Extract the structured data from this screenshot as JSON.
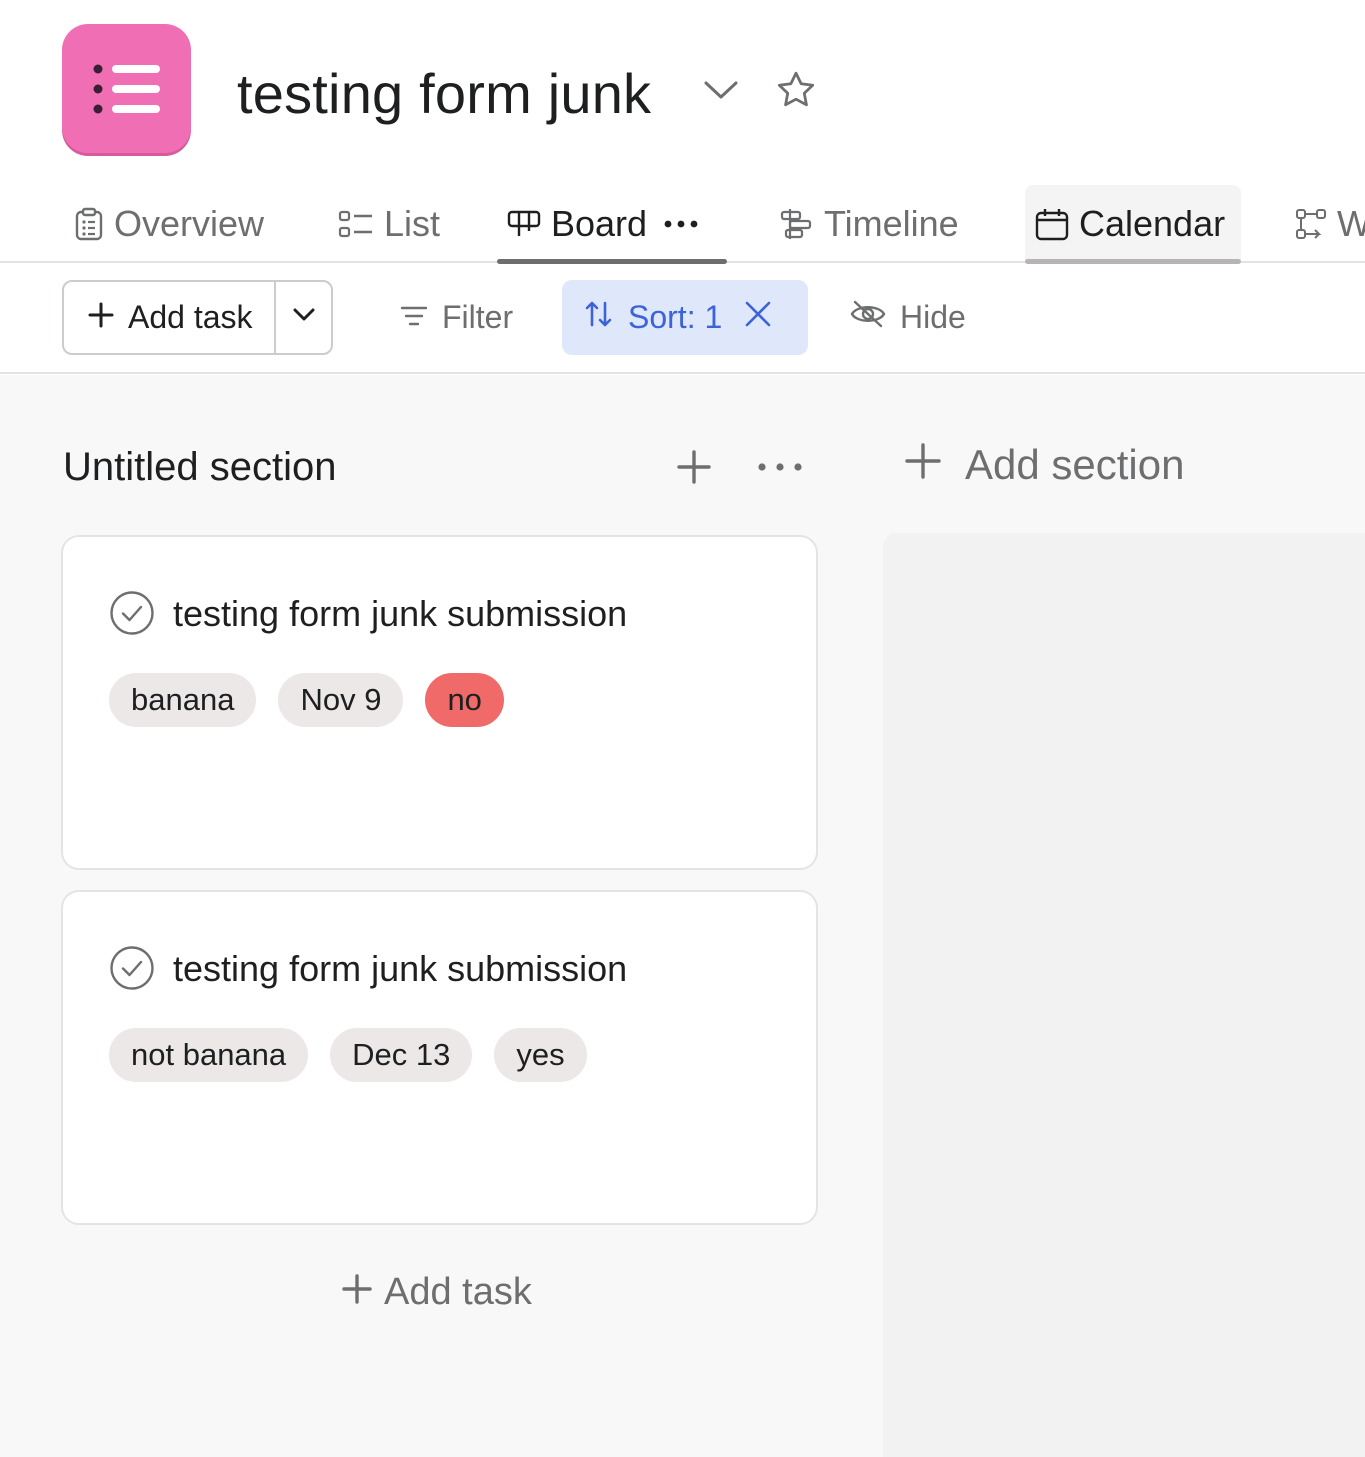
{
  "header": {
    "title": "testing form junk",
    "icon": "list-icon",
    "icon_color": "#f06fb4"
  },
  "tabs": [
    {
      "label": "Overview",
      "icon": "clipboard-icon"
    },
    {
      "label": "List",
      "icon": "list-view-icon"
    },
    {
      "label": "Board",
      "icon": "board-icon",
      "active": true
    },
    {
      "label": "Timeline",
      "icon": "timeline-icon"
    },
    {
      "label": "Calendar",
      "icon": "calendar-icon"
    },
    {
      "label": "W",
      "icon": "workflow-icon"
    }
  ],
  "toolbar": {
    "add_task": "Add task",
    "filter": "Filter",
    "sort": "Sort: 1",
    "hide": "Hide",
    "sort_color": "#3c63d7"
  },
  "board": {
    "section_title": "Untitled section",
    "add_section": "Add section",
    "add_task": "Add task",
    "cards": [
      {
        "title": "testing form junk submission",
        "chips": [
          {
            "text": "banana"
          },
          {
            "text": "Nov 9"
          },
          {
            "text": "no",
            "color": "#f06a6a"
          }
        ]
      },
      {
        "title": "testing form junk submission",
        "chips": [
          {
            "text": "not banana"
          },
          {
            "text": "Dec 13"
          },
          {
            "text": "yes"
          }
        ]
      }
    ]
  }
}
